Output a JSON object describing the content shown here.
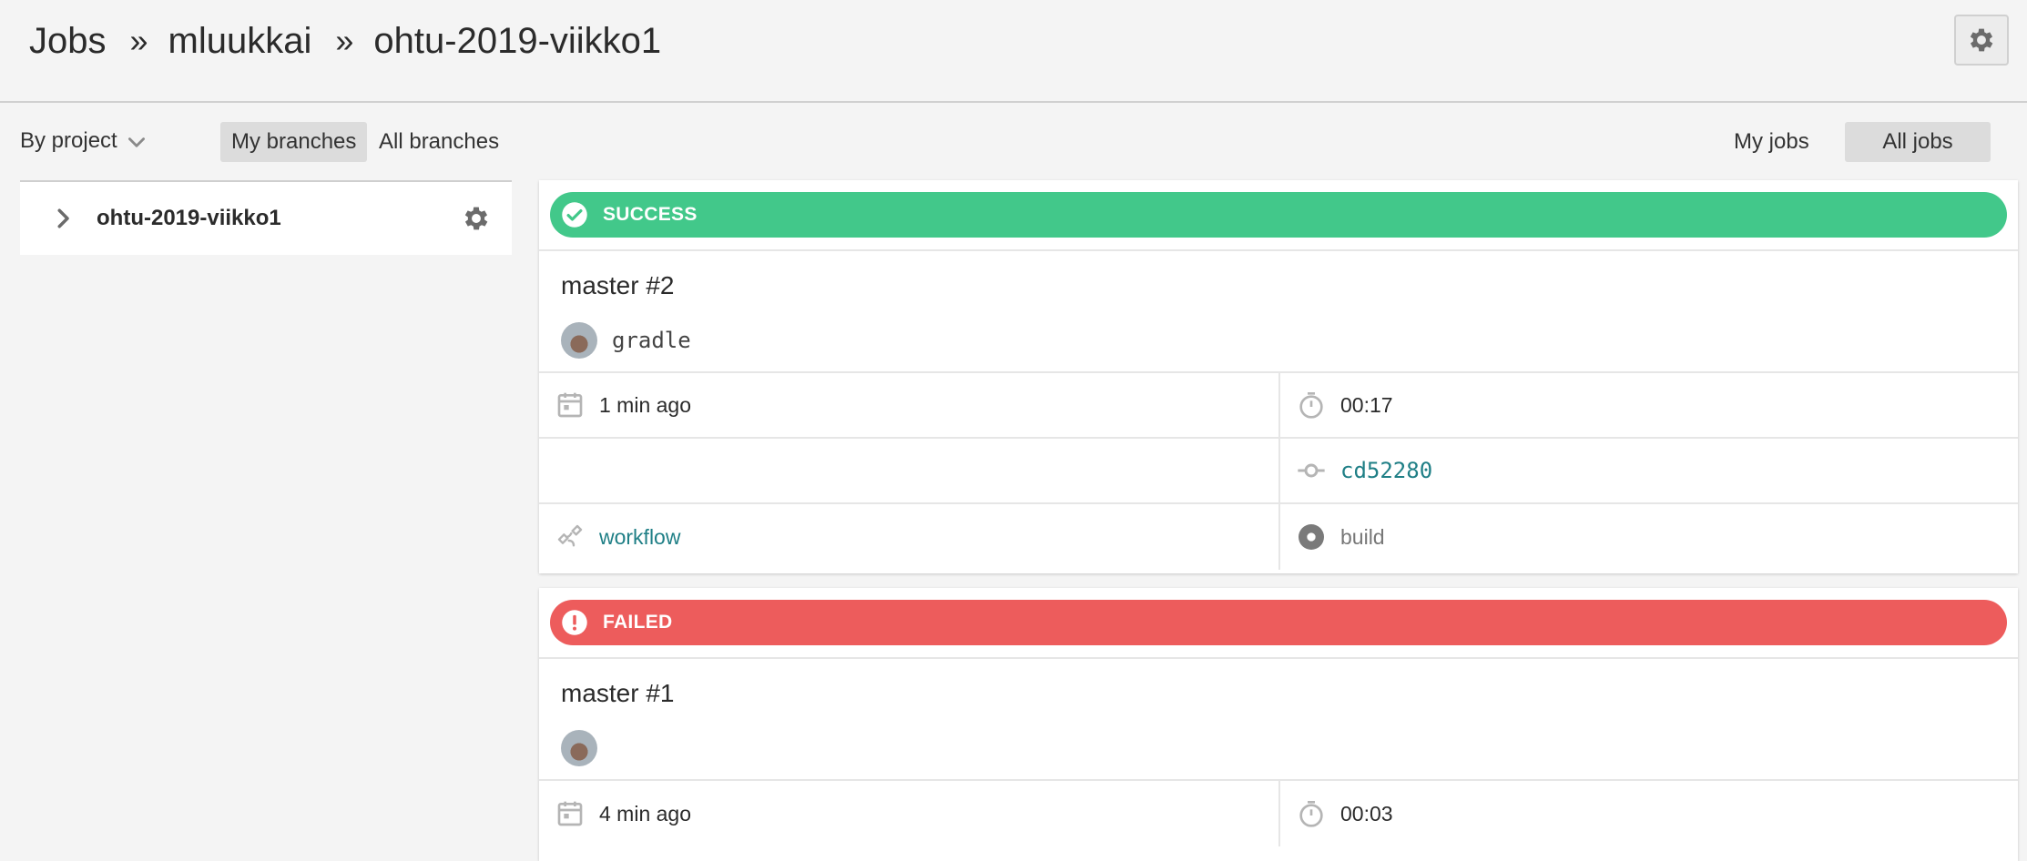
{
  "breadcrumb": {
    "root": "Jobs",
    "separator": "»",
    "org": "mluukkai",
    "project": "ohtu-2019-viikko1"
  },
  "header": {
    "settings_icon": "gear-icon"
  },
  "filters": {
    "group_by": "By project",
    "branch_tabs": [
      {
        "label": "My branches",
        "active": true
      },
      {
        "label": "All branches",
        "active": false
      }
    ],
    "job_tabs": [
      {
        "label": "My jobs",
        "active": false
      },
      {
        "label": "All jobs",
        "active": true
      }
    ]
  },
  "sidebar": {
    "project_name": "ohtu-2019-viikko1"
  },
  "jobs": [
    {
      "status": "SUCCESS",
      "status_color": "#42c88a",
      "title": "master #2",
      "commit_message": "gradle",
      "time_ago": "1 min ago",
      "duration": "00:17",
      "commit_hash": "cd52280",
      "workflow": "workflow",
      "job_name": "build"
    },
    {
      "status": "FAILED",
      "status_color": "#ed5c5c",
      "title": "master #1",
      "commit_message": "",
      "time_ago": "4 min ago",
      "duration": "00:03"
    }
  ]
}
